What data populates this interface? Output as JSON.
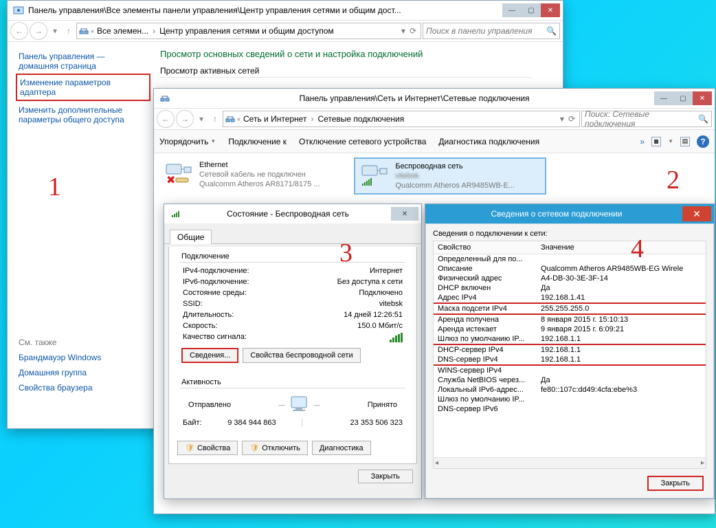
{
  "win1": {
    "title": "Панель управления\\Все элементы панели управления\\Центр управления сетями и общим дост...",
    "crumb1": "Все элемен...",
    "crumb2": "Центр управления сетями и общим доступом",
    "search": "Поиск в панели управления",
    "side_home1": "Панель управления —",
    "side_home2": "домашняя страница",
    "side_change1": "Изменение параметров",
    "side_change2": "адаптера",
    "side_adv1": "Изменить дополнительные",
    "side_adv2": "параметры общего доступа",
    "see_also": "См. также",
    "fw": "Брандмауэр Windows",
    "hg": "Домашняя группа",
    "bp": "Свойства браузера",
    "main_h": "Просмотр основных сведений о сети и настройка подключений",
    "main_sub": "Просмотр активных сетей"
  },
  "win2": {
    "title": "Панель управления\\Сеть и Интернет\\Сетевые подключения",
    "crumb1": "Сеть и Интернет",
    "crumb2": "Сетевые подключения",
    "search": "Поиск: Сетевые подключения",
    "cmd_org": "Упорядочить",
    "cmd_conn": "Подключение к",
    "cmd_dis": "Отключение сетевого устройства",
    "cmd_diag": "Диагностика подключения",
    "eth_name": "Ethernet",
    "eth_status": "Сетевой кабель не подключен",
    "eth_dev": "Qualcomm Atheros AR8171/8175 ...",
    "wifi_name": "Беспроводная сеть",
    "wifi_net": "vitebsk",
    "wifi_dev": "Qualcomm Atheros AR9485WB-E..."
  },
  "win3": {
    "title": "Состояние - Беспроводная сеть",
    "tab": "Общие",
    "grp_conn": "Подключение",
    "r_ipv4": "IPv4-подключение:",
    "v_ipv4": "Интернет",
    "r_ipv6": "IPv6-подключение:",
    "v_ipv6": "Без доступа к сети",
    "r_media": "Состояние среды:",
    "v_media": "Подключено",
    "r_ssid": "SSID:",
    "v_ssid": "vitebsk",
    "r_dur": "Длительность:",
    "v_dur": "14 дней 12:26:51",
    "r_spd": "Скорость:",
    "v_spd": "150.0 Мбит/с",
    "r_sig": "Качество сигнала:",
    "btn_det": "Сведения...",
    "btn_wprops": "Свойства беспроводной сети",
    "grp_act": "Активность",
    "sent": "Отправлено",
    "recv": "Принято",
    "bytes": "Байт:",
    "v_sent": "9 384 944 863",
    "v_recv": "23 353 506 323",
    "btn_props": "Свойства",
    "btn_disc": "Отключить",
    "btn_diag": "Диагностика",
    "btn_close": "Закрыть"
  },
  "win4": {
    "title": "Сведения о сетевом подключении",
    "caption": "Сведения о подключении к сети:",
    "h_prop": "Свойство",
    "h_val": "Значение",
    "rows": [
      {
        "k": "Определенный для по...",
        "v": ""
      },
      {
        "k": "Описание",
        "v": "Qualcomm Atheros AR9485WB-EG Wirele"
      },
      {
        "k": "Физический адрес",
        "v": "A4-DB-30-3E-3F-14"
      },
      {
        "k": "DHCP включен",
        "v": "Да"
      },
      {
        "k": "Адрес IPv4",
        "v": "192.168.1.41",
        "u": true
      },
      {
        "k": "Маска подсети IPv4",
        "v": "255.255.255.0",
        "u": true
      },
      {
        "k": "Аренда получена",
        "v": "8 января 2015 г. 15:10:13"
      },
      {
        "k": "Аренда истекает",
        "v": "9 января 2015 г. 6:09:21"
      },
      {
        "k": "Шлюз по умолчанию IP...",
        "v": "192.168.1.1",
        "u": true
      },
      {
        "k": "DHCP-сервер IPv4",
        "v": "192.168.1.1"
      },
      {
        "k": "DNS-сервер IPv4",
        "v": "192.168.1.1",
        "u": true
      },
      {
        "k": "WINS-сервер IPv4",
        "v": ""
      },
      {
        "k": "Служба NetBIOS через...",
        "v": "Да"
      },
      {
        "k": "Локальный IPv6-адрес...",
        "v": "fe80::107c:dd49:4cfa:ebe%3"
      },
      {
        "k": "Шлюз по умолчанию IP...",
        "v": ""
      },
      {
        "k": "DNS-сервер IPv6",
        "v": ""
      }
    ],
    "btn_close": "Закрыть"
  },
  "nums": {
    "n1": "1",
    "n2": "2",
    "n3": "3",
    "n4": "4"
  }
}
